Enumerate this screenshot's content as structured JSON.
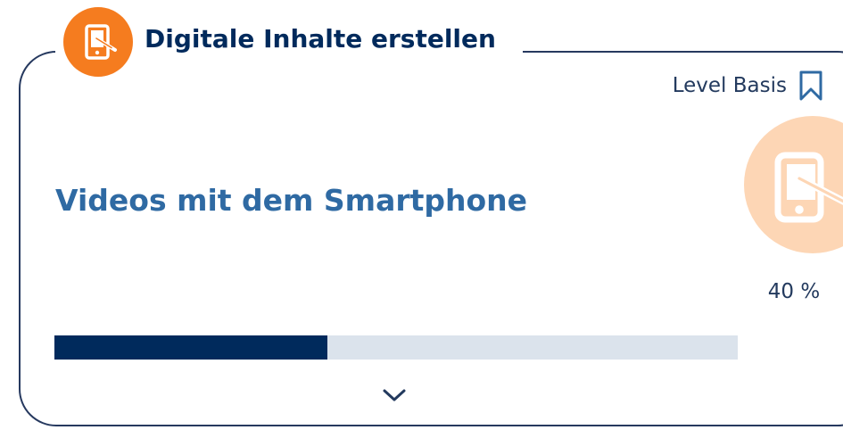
{
  "category": {
    "title": "Digitale Inhalte erstellen",
    "icon": "tablet-edit-icon",
    "color": "#f57c1f"
  },
  "level": {
    "label": "Level Basis",
    "icon": "bookmark-icon"
  },
  "course": {
    "title": "Videos mit dem Smartphone"
  },
  "progress": {
    "percent": 40,
    "percent_label": "40 %",
    "fill_color": "#002a5c",
    "track_color": "#dbe3ec",
    "badge_color": "#fdd6b5"
  },
  "expand": {
    "icon": "chevron-down-icon"
  }
}
